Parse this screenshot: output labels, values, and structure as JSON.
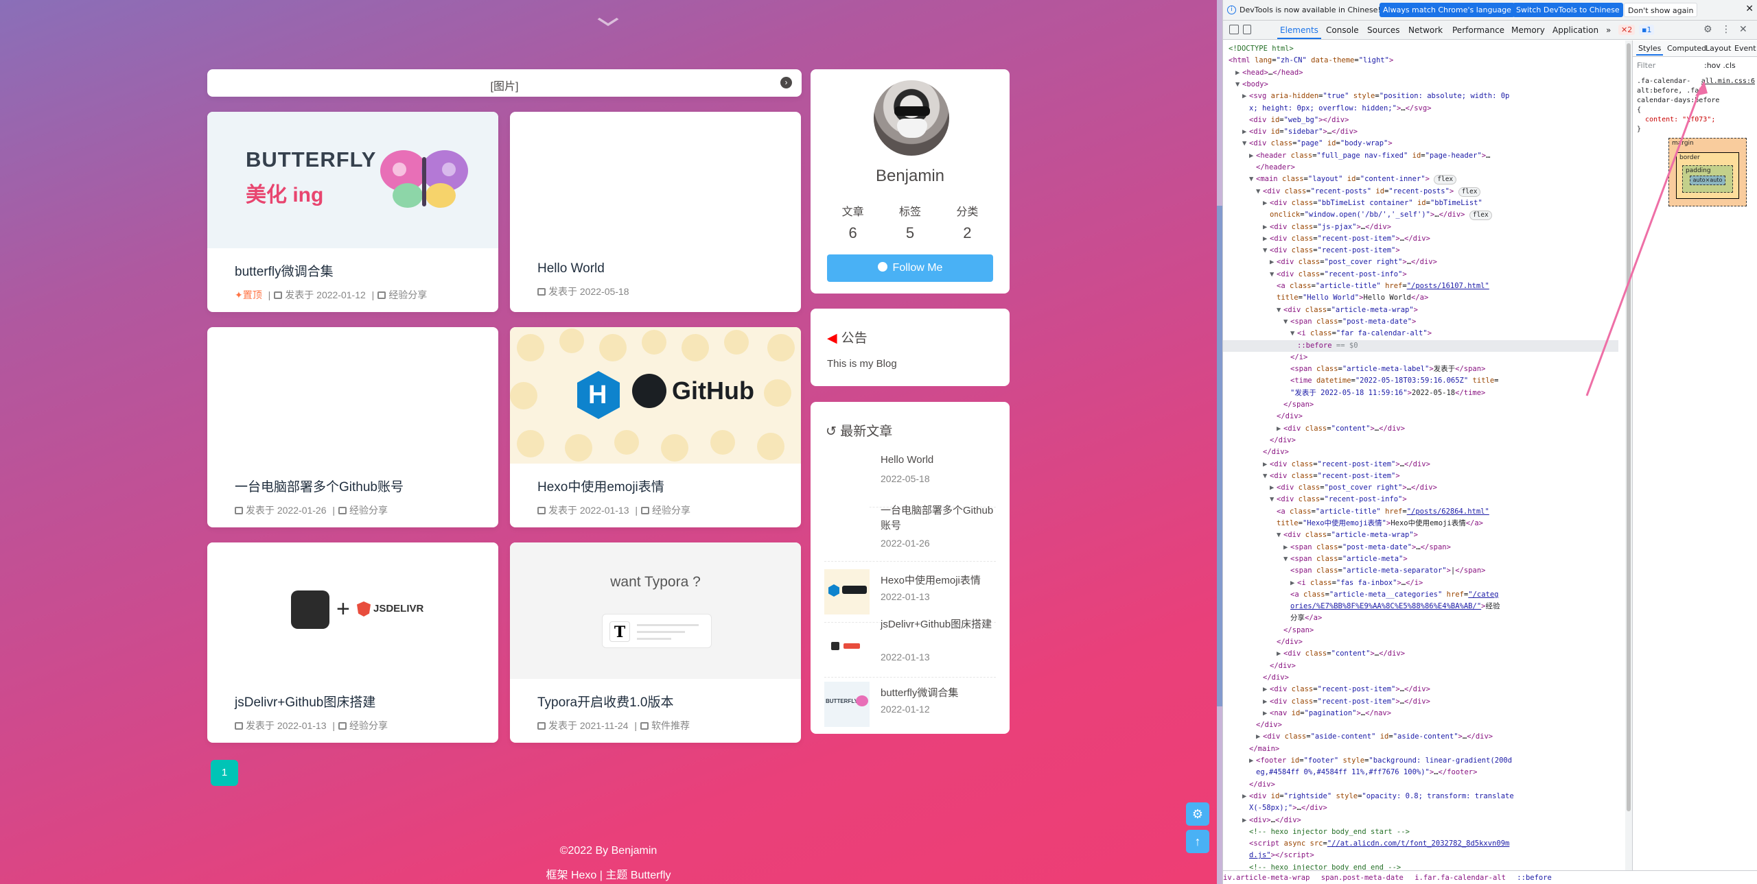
{
  "blog": {
    "bb_text": "[图片]",
    "posts": [
      {
        "title": "butterfly微调合集",
        "sticky": "置顶",
        "date": "发表于 2022-01-12",
        "category": "经验分享",
        "cover_text1": "BUTTERFLY",
        "cover_text2": "美化 ing"
      },
      {
        "title": "Hello World",
        "date": "发表于 2022-05-18"
      },
      {
        "title": "一台电脑部署多个Github账号",
        "date": "发表于 2022-01-26",
        "category": "经验分享"
      },
      {
        "title": "Hexo中使用emoji表情",
        "date": "发表于 2022-01-13",
        "category": "经验分享",
        "cover_text": "GitHub",
        "cover_letter": "H"
      },
      {
        "title": "jsDelivr+Github图床搭建",
        "date": "发表于 2022-01-13",
        "category": "经验分享",
        "cover_plus": "+",
        "cover_text": "JSDELIVR"
      },
      {
        "title": "Typora开启收费1.0版本",
        "date": "发表于 2021-11-24",
        "category": "软件推荐",
        "cover_text": "want Typora ?",
        "cover_letter": "T"
      }
    ],
    "author": {
      "name": "Benjamin",
      "stats": [
        {
          "label": "文章",
          "value": "6"
        },
        {
          "label": "标签",
          "value": "5"
        },
        {
          "label": "分类",
          "value": "2"
        }
      ],
      "follow_label": "Follow Me"
    },
    "notice": {
      "title": "公告",
      "body": "This is my Blog"
    },
    "recent": {
      "title": "最新文章",
      "items": [
        {
          "title": "Hello World",
          "date": "2022-05-18"
        },
        {
          "title": "一台电脑部署多个Github账号",
          "date": "2022-01-26"
        },
        {
          "title": "Hexo中使用emoji表情",
          "date": "2022-01-13"
        },
        {
          "title": "jsDelivr+Github图床搭建",
          "date": "2022-01-13"
        },
        {
          "title": "butterfly微调合集",
          "date": "2022-01-12"
        }
      ]
    },
    "pagination": {
      "current": "1"
    },
    "footer": {
      "copyright": "©2022 By Benjamin",
      "framework": "框架 Hexo | 主题 Butterfly"
    }
  },
  "devtools": {
    "banner": {
      "message": "DevTools is now available in Chinese!",
      "btn1": "Always match Chrome's language",
      "btn2": "Switch DevTools to Chinese",
      "btn3": "Don't show again"
    },
    "tabs": [
      "Elements",
      "Console",
      "Sources",
      "Network",
      "Performance",
      "Memory",
      "Application"
    ],
    "active_tab": "Elements",
    "error_count": "2",
    "message_count": "1",
    "styles_tabs": [
      "Styles",
      "Computed",
      "Layout",
      "Event Listeners"
    ],
    "filter_placeholder": "Filter",
    "hov_cls": ":hov  .cls",
    "rule": {
      "selector": ".fa-calendar-alt:before, .fa-calendar-days:before {",
      "prop": "content: \"\\f073\";",
      "close": "}",
      "source": "all.min.css:6"
    },
    "box_model": {
      "margin": "margin",
      "border": "border",
      "padding": "padding",
      "content": "auto×auto",
      "dash": "–"
    },
    "breadcrumb": [
      "iv.article-meta-wrap",
      "span.post-meta-date",
      "i.far.fa-calendar-alt",
      "::before"
    ]
  }
}
